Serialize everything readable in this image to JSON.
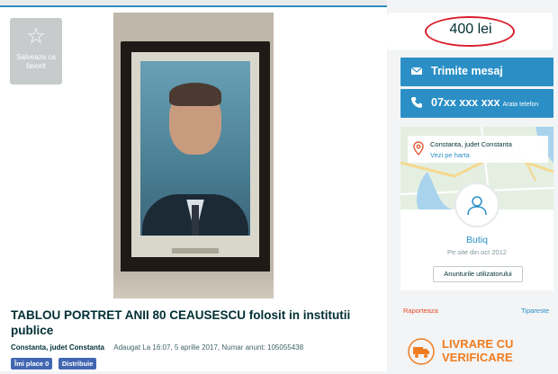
{
  "favorite": {
    "label": "Salveaza ca favorit",
    "icon": "star-icon"
  },
  "listing": {
    "title": "TABLOU PORTRET ANII 80 CEAUSESCU folosit in institutii publice",
    "location": "Constanta, judet Constanta",
    "added_info": "Adaugat La 16:07, 5 aprilie 2017, Numar anunt: 105055438",
    "like_label": "Îmi place 0",
    "share_label": "Distribuie"
  },
  "price": {
    "value": "400 lei",
    "highlight_color": "#d9202c"
  },
  "actions": {
    "message_label": "Trimite mesaj",
    "phone_label": "07xx xxx xxx",
    "phone_sub_label": "Arata telefon"
  },
  "seller": {
    "location": "Constanta, judet Constanta",
    "map_link": "Vezi pe harta",
    "name": "Butiq",
    "member_since": "Pe site din oct 2012",
    "ads_button": "Anunturile utilizatorului"
  },
  "footer_links": {
    "report": "Raporteaza",
    "print": "Tipareste"
  },
  "delivery": {
    "line1": "LIVRARE CU",
    "line2": "VERIFICARE"
  },
  "colors": {
    "accent": "#2b8fc6",
    "delivery": "#f07c1f",
    "report": "#e44b28"
  }
}
